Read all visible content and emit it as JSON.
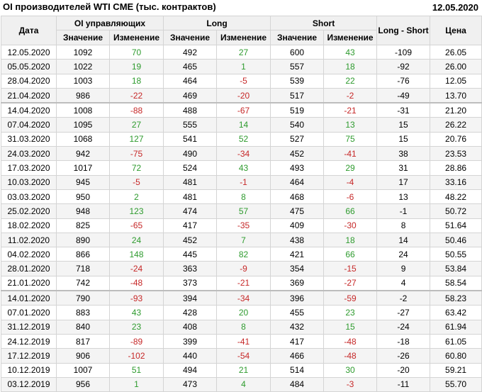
{
  "header": {
    "title": "OI производителей WTI CME (тыс. контрактов)",
    "date": "12.05.2020"
  },
  "columns": {
    "date": "Дата",
    "oi_group": "OI управляющих",
    "long_group": "Long",
    "short_group": "Short",
    "long_short": "Long - Short",
    "price": "Цена",
    "value": "Значение",
    "change": "Изменение"
  },
  "colors": {
    "positive": "#2e9b2e",
    "negative": "#c62828",
    "header_bg": "#f0f0f0"
  },
  "rows": [
    {
      "date": "12.05.2020",
      "oi": "1092",
      "oi_chg": "70",
      "long": "492",
      "long_chg": "27",
      "short": "600",
      "short_chg": "43",
      "ls": "-109",
      "price": "26.05"
    },
    {
      "date": "05.05.2020",
      "oi": "1022",
      "oi_chg": "19",
      "long": "465",
      "long_chg": "1",
      "short": "557",
      "short_chg": "18",
      "ls": "-92",
      "price": "26.00"
    },
    {
      "date": "28.04.2020",
      "oi": "1003",
      "oi_chg": "18",
      "long": "464",
      "long_chg": "-5",
      "short": "539",
      "short_chg": "22",
      "ls": "-76",
      "price": "12.05"
    },
    {
      "date": "21.04.2020",
      "oi": "986",
      "oi_chg": "-22",
      "long": "469",
      "long_chg": "-20",
      "short": "517",
      "short_chg": "-2",
      "ls": "-49",
      "price": "13.70"
    },
    {
      "date": "14.04.2020",
      "oi": "1008",
      "oi_chg": "-88",
      "long": "488",
      "long_chg": "-67",
      "short": "519",
      "short_chg": "-21",
      "ls": "-31",
      "price": "21.20"
    },
    {
      "date": "07.04.2020",
      "oi": "1095",
      "oi_chg": "27",
      "long": "555",
      "long_chg": "14",
      "short": "540",
      "short_chg": "13",
      "ls": "15",
      "price": "26.22"
    },
    {
      "date": "31.03.2020",
      "oi": "1068",
      "oi_chg": "127",
      "long": "541",
      "long_chg": "52",
      "short": "527",
      "short_chg": "75",
      "ls": "15",
      "price": "20.76"
    },
    {
      "date": "24.03.2020",
      "oi": "942",
      "oi_chg": "-75",
      "long": "490",
      "long_chg": "-34",
      "short": "452",
      "short_chg": "-41",
      "ls": "38",
      "price": "23.53"
    },
    {
      "date": "17.03.2020",
      "oi": "1017",
      "oi_chg": "72",
      "long": "524",
      "long_chg": "43",
      "short": "493",
      "short_chg": "29",
      "ls": "31",
      "price": "28.86"
    },
    {
      "date": "10.03.2020",
      "oi": "945",
      "oi_chg": "-5",
      "long": "481",
      "long_chg": "-1",
      "short": "464",
      "short_chg": "-4",
      "ls": "17",
      "price": "33.16"
    },
    {
      "date": "03.03.2020",
      "oi": "950",
      "oi_chg": "2",
      "long": "481",
      "long_chg": "8",
      "short": "468",
      "short_chg": "-6",
      "ls": "13",
      "price": "48.22"
    },
    {
      "date": "25.02.2020",
      "oi": "948",
      "oi_chg": "123",
      "long": "474",
      "long_chg": "57",
      "short": "475",
      "short_chg": "66",
      "ls": "-1",
      "price": "50.72"
    },
    {
      "date": "18.02.2020",
      "oi": "825",
      "oi_chg": "-65",
      "long": "417",
      "long_chg": "-35",
      "short": "409",
      "short_chg": "-30",
      "ls": "8",
      "price": "51.64"
    },
    {
      "date": "11.02.2020",
      "oi": "890",
      "oi_chg": "24",
      "long": "452",
      "long_chg": "7",
      "short": "438",
      "short_chg": "18",
      "ls": "14",
      "price": "50.46"
    },
    {
      "date": "04.02.2020",
      "oi": "866",
      "oi_chg": "148",
      "long": "445",
      "long_chg": "82",
      "short": "421",
      "short_chg": "66",
      "ls": "24",
      "price": "50.55"
    },
    {
      "date": "28.01.2020",
      "oi": "718",
      "oi_chg": "-24",
      "long": "363",
      "long_chg": "-9",
      "short": "354",
      "short_chg": "-15",
      "ls": "9",
      "price": "53.84"
    },
    {
      "date": "21.01.2020",
      "oi": "742",
      "oi_chg": "-48",
      "long": "373",
      "long_chg": "-21",
      "short": "369",
      "short_chg": "-27",
      "ls": "4",
      "price": "58.54"
    },
    {
      "date": "14.01.2020",
      "oi": "790",
      "oi_chg": "-93",
      "long": "394",
      "long_chg": "-34",
      "short": "396",
      "short_chg": "-59",
      "ls": "-2",
      "price": "58.23"
    },
    {
      "date": "07.01.2020",
      "oi": "883",
      "oi_chg": "43",
      "long": "428",
      "long_chg": "20",
      "short": "455",
      "short_chg": "23",
      "ls": "-27",
      "price": "63.42"
    },
    {
      "date": "31.12.2019",
      "oi": "840",
      "oi_chg": "23",
      "long": "408",
      "long_chg": "8",
      "short": "432",
      "short_chg": "15",
      "ls": "-24",
      "price": "61.94"
    },
    {
      "date": "24.12.2019",
      "oi": "817",
      "oi_chg": "-89",
      "long": "399",
      "long_chg": "-41",
      "short": "417",
      "short_chg": "-48",
      "ls": "-18",
      "price": "61.05"
    },
    {
      "date": "17.12.2019",
      "oi": "906",
      "oi_chg": "-102",
      "long": "440",
      "long_chg": "-54",
      "short": "466",
      "short_chg": "-48",
      "ls": "-26",
      "price": "60.80"
    },
    {
      "date": "10.12.2019",
      "oi": "1007",
      "oi_chg": "51",
      "long": "494",
      "long_chg": "21",
      "short": "514",
      "short_chg": "30",
      "ls": "-20",
      "price": "59.21"
    },
    {
      "date": "03.12.2019",
      "oi": "956",
      "oi_chg": "1",
      "long": "473",
      "long_chg": "4",
      "short": "484",
      "short_chg": "-3",
      "ls": "-11",
      "price": "55.70"
    }
  ]
}
